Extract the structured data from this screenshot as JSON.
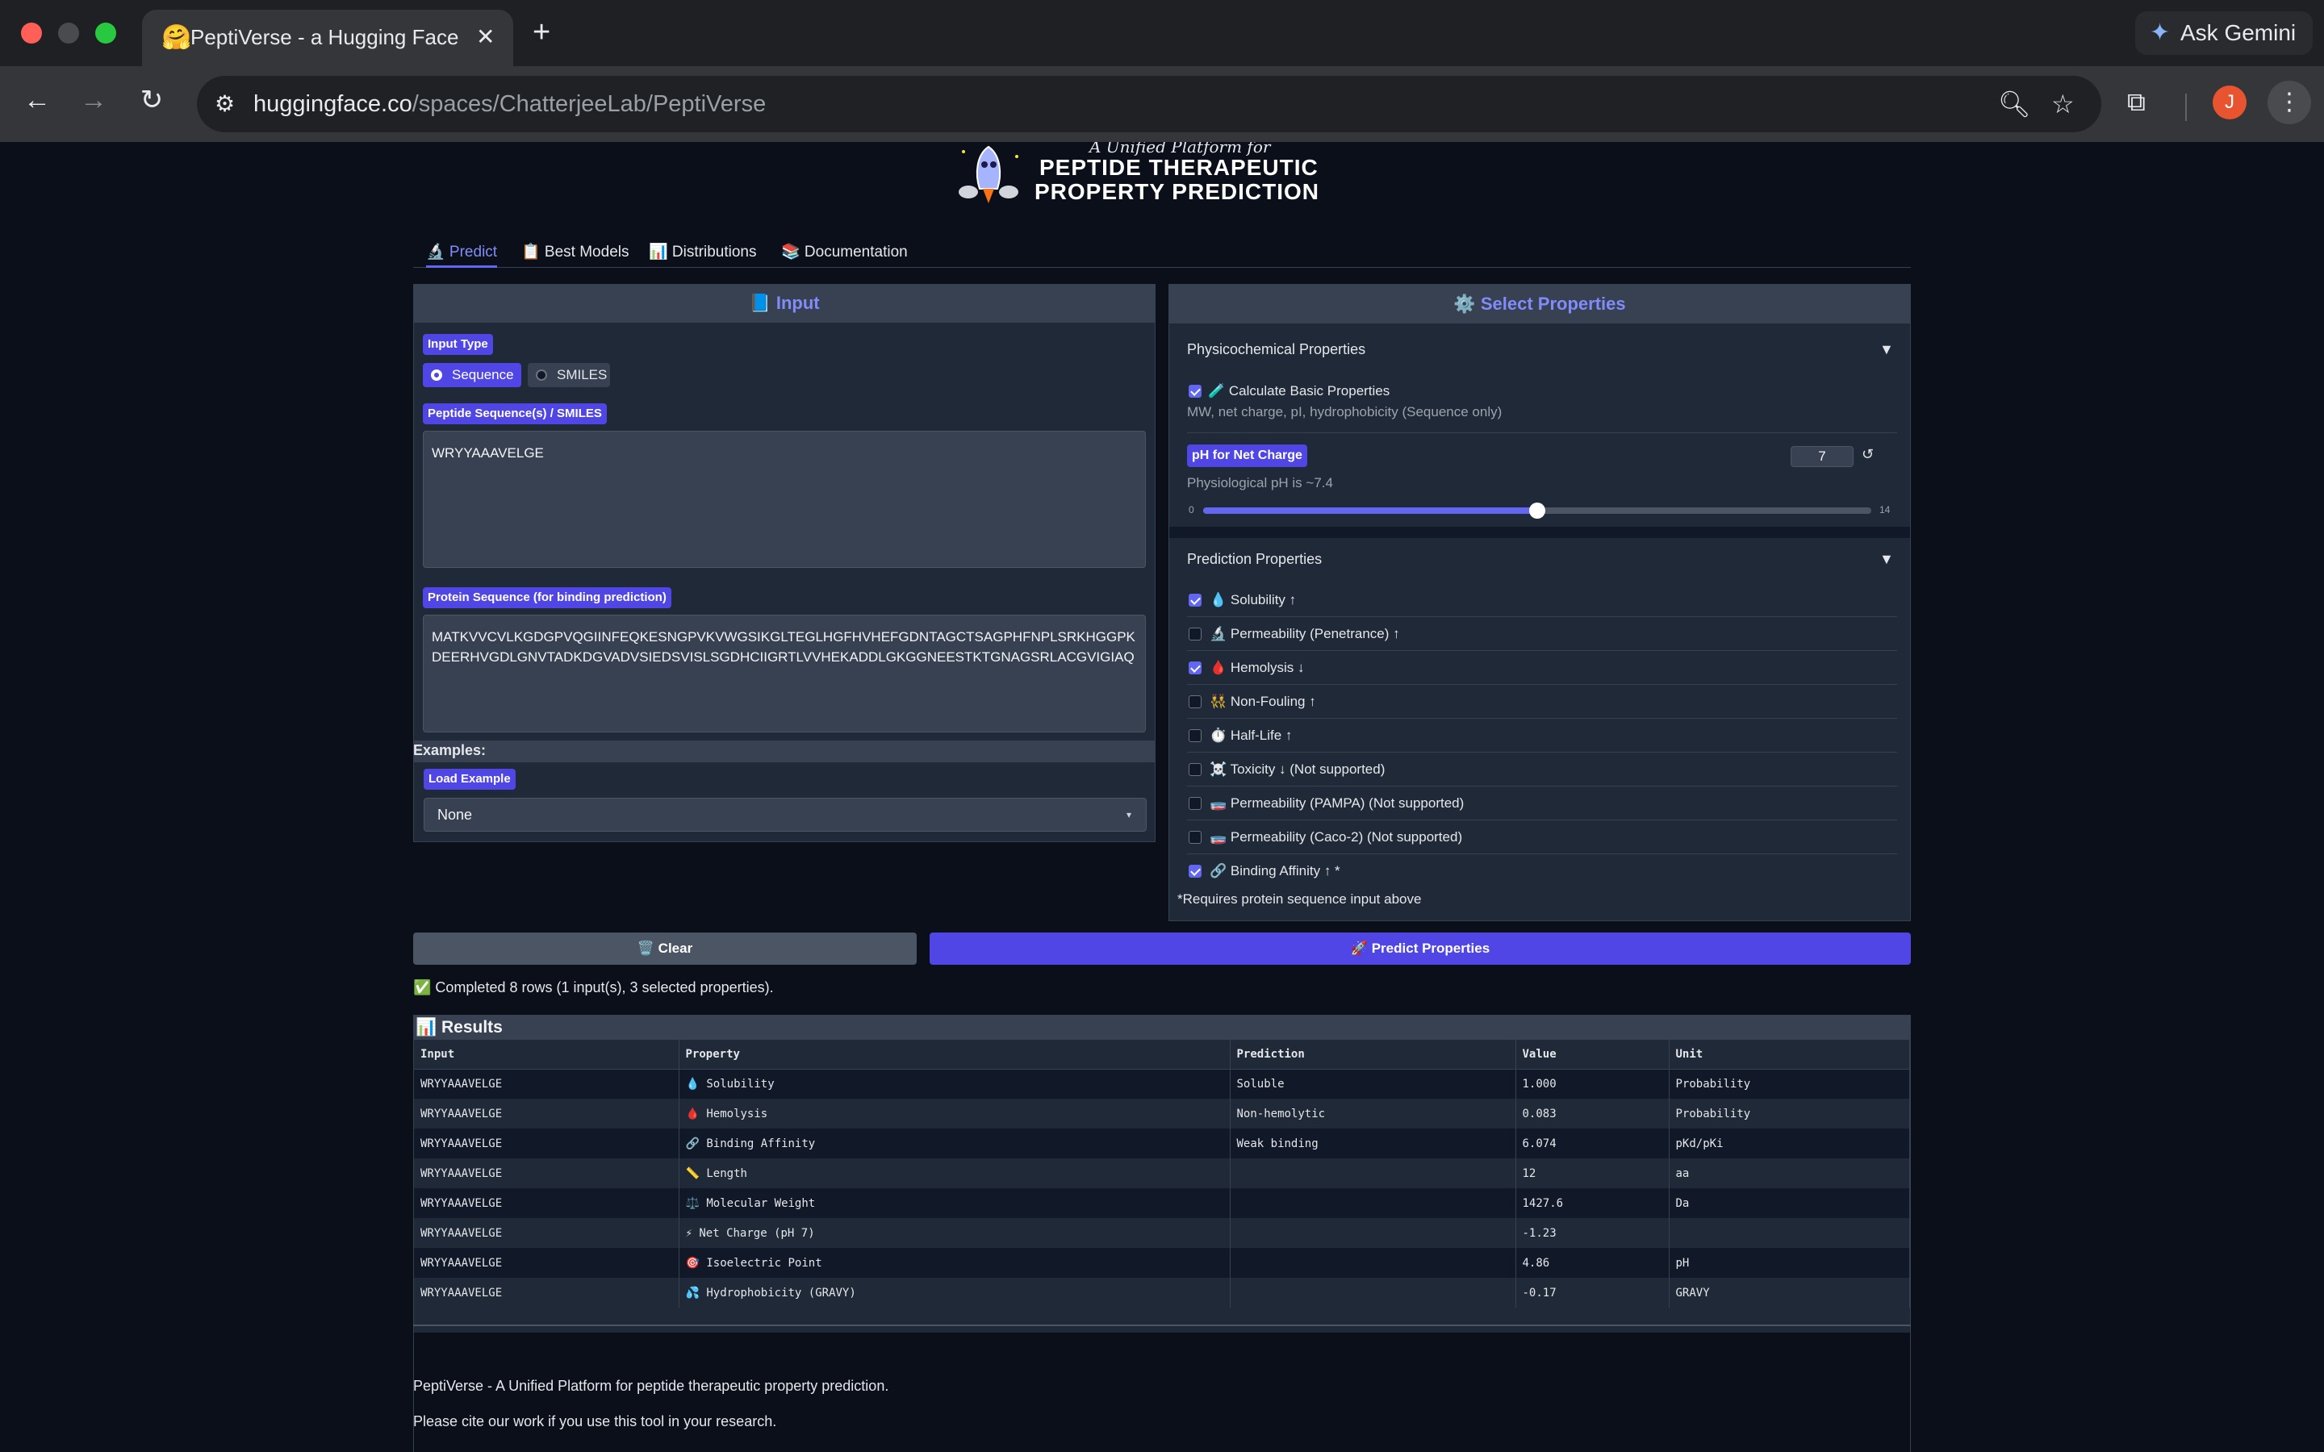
{
  "browser": {
    "tab_title": "PeptiVerse - a Hugging Face Space",
    "tab_favicon": "hugging-face-icon",
    "url_host": "huggingface.co",
    "url_path": "/spaces/ChatterjeeLab/PeptiVerse",
    "gemini_label": "Ask Gemini",
    "avatar_letter": "J"
  },
  "logo": {
    "subtitle": "A Unified Platform for",
    "line1": "PEPTIDE THERAPEUTIC",
    "line2": "PROPERTY PREDICTION"
  },
  "tabs": [
    {
      "label": "🔬 Predict",
      "active": true
    },
    {
      "label": "📋 Best Models",
      "active": false
    },
    {
      "label": "📊 Distributions",
      "active": false
    },
    {
      "label": "📚 Documentation",
      "active": false
    }
  ],
  "input_panel": {
    "title": "📘 Input",
    "input_type_label": "Input Type",
    "input_type_options": [
      "Sequence",
      "SMILES"
    ],
    "input_type_selected": "Sequence",
    "peptide_label": "Peptide Sequence(s) / SMILES",
    "peptide_value": "WRYYAAAVELGE",
    "protein_label": "Protein Sequence (for binding prediction)",
    "protein_value": "MATKVVCVLKGDGPVQGIINFEQKESNGPVKVWGSIKGLTEGLHGFHVHEFGDNTAGCTSAGPHFNPLSRKHGGPKDEERHVGDLGNVTADKDGVADVSIEDSVISLSGDHCIIGRTLVVHEKADDLGKGGNEESTKTGNAGSRLACGVIGIAQ",
    "examples_heading": "Examples:",
    "load_example_label": "Load Example",
    "load_example_value": "None"
  },
  "properties_panel": {
    "title": "⚙️ Select Properties",
    "physchem_title": "Physicochemical Properties",
    "basic_label": "🧪 Calculate Basic Properties",
    "basic_checked": true,
    "basic_desc": "MW, net charge, pI, hydrophobicity (Sequence only)",
    "ph_label": "pH for Net Charge",
    "ph_value": "7",
    "ph_value_number": 7,
    "ph_desc": "Physiological pH is ~7.4",
    "ph_min": "0",
    "ph_max": "14",
    "ph_min_number": 0,
    "ph_max_number": 14,
    "prediction_title": "Prediction Properties",
    "items": [
      {
        "label": "💧 Solubility ↑",
        "checked": true
      },
      {
        "label": "🔬 Permeability (Penetrance) ↑",
        "checked": false
      },
      {
        "label": "🩸 Hemolysis ↓",
        "checked": true
      },
      {
        "label": "👯 Non-Fouling ↑",
        "checked": false
      },
      {
        "label": "⏱️ Half-Life ↑",
        "checked": false
      },
      {
        "label": "☠️ Toxicity ↓ (Not supported)",
        "checked": false
      },
      {
        "label": "🧫 Permeability (PAMPA) (Not supported)",
        "checked": false
      },
      {
        "label": "🧫 Permeability (Caco-2) (Not supported)",
        "checked": false
      },
      {
        "label": "🔗 Binding Affinity ↑ *",
        "checked": true
      }
    ],
    "footnote": "*Requires protein sequence input above"
  },
  "actions": {
    "clear_label": "🗑️ Clear",
    "predict_label": "🚀 Predict Properties"
  },
  "status": "✅ Completed 8 rows (1 input(s), 3 selected properties).",
  "results": {
    "title": "📊 Results",
    "columns": [
      "Input",
      "Property",
      "Prediction",
      "Value",
      "Unit"
    ],
    "rows": [
      [
        "WRYYAAAVELGE",
        "💧 Solubility",
        "Soluble",
        "1.000",
        "Probability"
      ],
      [
        "WRYYAAAVELGE",
        "🩸 Hemolysis",
        "Non-hemolytic",
        "0.083",
        "Probability"
      ],
      [
        "WRYYAAAVELGE",
        "🔗 Binding Affinity",
        "Weak binding",
        "6.074",
        "pKd/pKi"
      ],
      [
        "WRYYAAAVELGE",
        "📏 Length",
        "",
        "12",
        "aa"
      ],
      [
        "WRYYAAAVELGE",
        "⚖️ Molecular Weight",
        "",
        "1427.6",
        "Da"
      ],
      [
        "WRYYAAAVELGE",
        "⚡ Net Charge (pH 7)",
        "",
        "-1.23",
        ""
      ],
      [
        "WRYYAAAVELGE",
        "🎯 Isoelectric Point",
        "",
        "4.86",
        "pH"
      ],
      [
        "WRYYAAAVELGE",
        "💦 Hydrophobicity (GRAVY)",
        "",
        "-0.17",
        "GRAVY"
      ]
    ]
  },
  "footer": {
    "line1": "PeptiVerse - A Unified Platform for peptide therapeutic property prediction.",
    "line2": "Please cite our work if you use this tool in your research."
  },
  "colors": {
    "accent": "#4f46e5",
    "accent_text": "#818cf8",
    "page_bg": "#0b0f19",
    "panel_bg": "#1f2937"
  }
}
